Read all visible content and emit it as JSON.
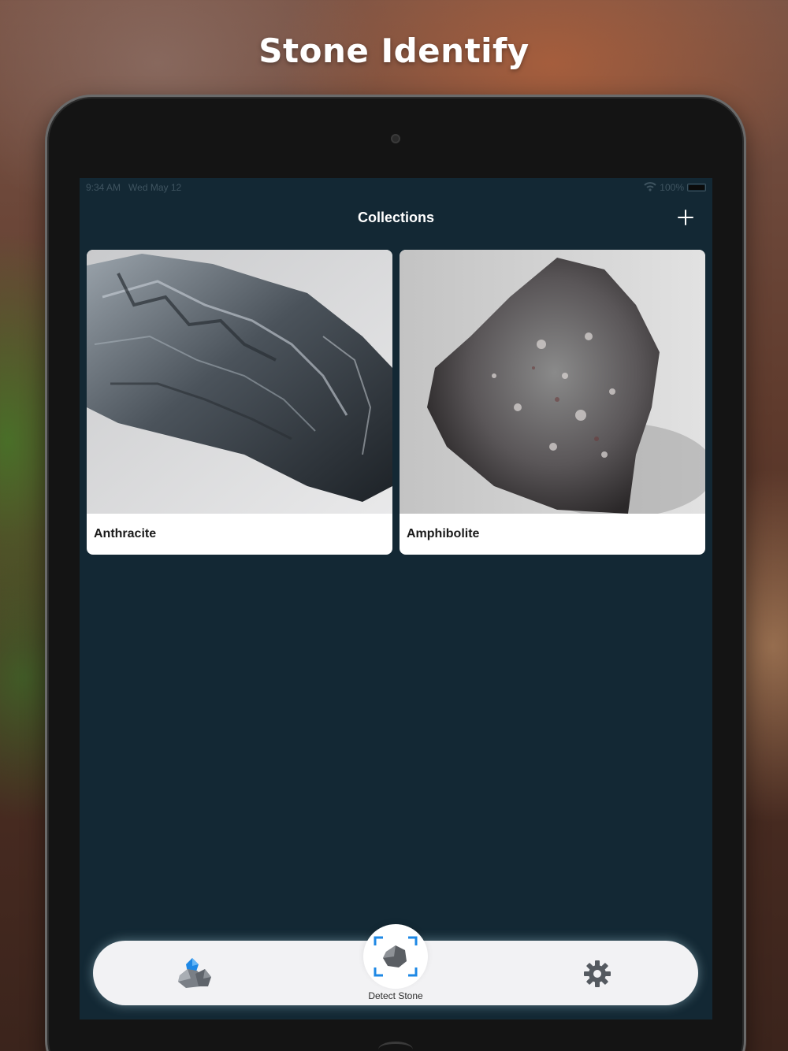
{
  "headline": "Stone Identify",
  "status_bar": {
    "time": "9:34 AM",
    "date": "Wed May 12",
    "battery": "100%"
  },
  "nav": {
    "title": "Collections",
    "add_icon": "plus-icon"
  },
  "collections": [
    {
      "name": "Anthracite",
      "image": "anthracite-photo"
    },
    {
      "name": "Amphibolite",
      "image": "amphibolite-photo"
    }
  ],
  "tabbar": {
    "collections_icon": "stones-icon",
    "detect_icon": "scan-stone-icon",
    "detect_label": "Detect Stone",
    "settings_icon": "gear-icon"
  },
  "colors": {
    "screen_bg": "#132834",
    "accent_blue": "#1e88e5",
    "tabbar_bg": "#f2f2f4"
  }
}
